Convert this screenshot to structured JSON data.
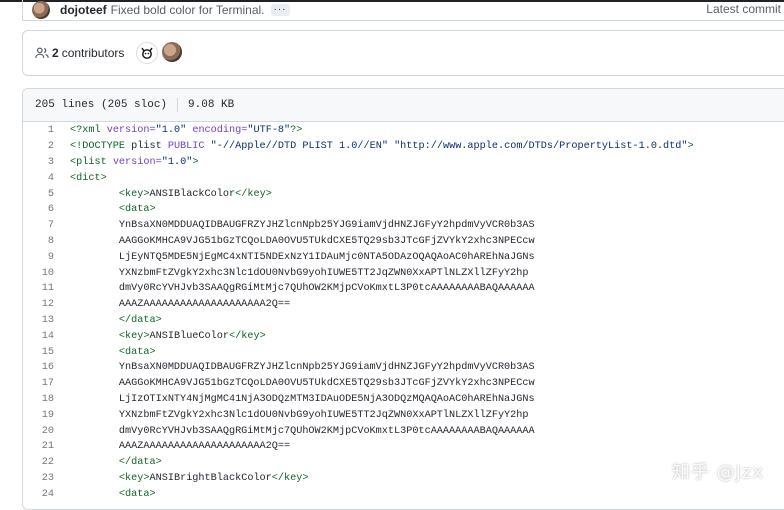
{
  "commit": {
    "author": "dojoteef",
    "message": "Fixed bold color for Terminal.",
    "more_label": "···",
    "latest_label": "Latest commit"
  },
  "contributors": {
    "count": "2",
    "label": "contributors"
  },
  "file": {
    "lines_info": "205 lines (205 sloc)",
    "size": "9.08 KB"
  },
  "code_lines": [
    {
      "n": "1",
      "text": "<?xml version=\"1.0\" encoding=\"UTF-8\"?>"
    },
    {
      "n": "2",
      "text": "<!DOCTYPE plist PUBLIC \"-//Apple//DTD PLIST 1.0//EN\" \"http://www.apple.com/DTDs/PropertyList-1.0.dtd\">"
    },
    {
      "n": "3",
      "text": "<plist version=\"1.0\">"
    },
    {
      "n": "4",
      "text": "<dict>"
    },
    {
      "n": "5",
      "text": "        <key>ANSIBlackColor</key>"
    },
    {
      "n": "6",
      "text": "        <data>"
    },
    {
      "n": "7",
      "text": "        YnBsaXN0MDDUAQIDBAUGFRZYJHZlcnNpb25YJG9iamVjdHNZJGFyY2hpdmVyVCR0b3AS"
    },
    {
      "n": "8",
      "text": "        AAGGoKMHCA9VJG51bGzTCQoLDA0OVU5TUkdCXE5TQ29sb3JTcGFjZVYkY2xhc3NPECcw"
    },
    {
      "n": "9",
      "text": "        LjEyNTQ5MDE5NjEgMC4xNTI5NDExNzY1IDAuMjc0NTA5ODAzOQAQAoAC0hAREhNaJGNs"
    },
    {
      "n": "10",
      "text": "        YXNzbmFtZVgkY2xhc3Nlc1dOU0NvbG9yohIUWE5TT2JqZWN0XxAPTlNLZXllZFyY2hp"
    },
    {
      "n": "11",
      "text": "        dmVy0RcYVHJvb3SAAQgRGiMtMjc7QUhOW2KMjpCVoKmxtL3P0tcAAAAAAAABAQAAAAAA"
    },
    {
      "n": "12",
      "text": "        AAAZAAAAAAAAAAAAAAAAAAAA2Q=="
    },
    {
      "n": "13",
      "text": "        </data>"
    },
    {
      "n": "14",
      "text": "        <key>ANSIBlueColor</key>"
    },
    {
      "n": "15",
      "text": "        <data>"
    },
    {
      "n": "16",
      "text": "        YnBsaXN0MDDUAQIDBAUGFRZYJHZlcnNpb25YJG9iamVjdHNZJGFyY2hpdmVyVCR0b3AS"
    },
    {
      "n": "17",
      "text": "        AAGGoKMHCA9VJG51bGzTCQoLDA0OVU5TUkdCXE5TQ29sb3JTcGFjZVYkY2xhc3NPECcw"
    },
    {
      "n": "18",
      "text": "        LjIzOTIxNTY4NjMgMC41NjA3ODQzMTM3IDAuODE5NjA3ODQzMQAQAoAC0hAREhNaJGNs"
    },
    {
      "n": "19",
      "text": "        YXNzbmFtZVgkY2xhc3Nlc1dOU0NvbG9yohIUWE5TT2JqZWN0XxAPTlNLZXllZFyY2hp"
    },
    {
      "n": "20",
      "text": "        dmVy0RcYVHJvb3SAAQgRGiMtMjc7QUhOW2KMjpCVoKmxtL3P0tcAAAAAAAABAQAAAAAA"
    },
    {
      "n": "21",
      "text": "        AAAZAAAAAAAAAAAAAAAAAAAA2Q=="
    },
    {
      "n": "22",
      "text": "        </data>"
    },
    {
      "n": "23",
      "text": "        <key>ANSIBrightBlackColor</key>"
    },
    {
      "n": "24",
      "text": "        <data>"
    }
  ],
  "watermark": "知乎 @Jzx"
}
